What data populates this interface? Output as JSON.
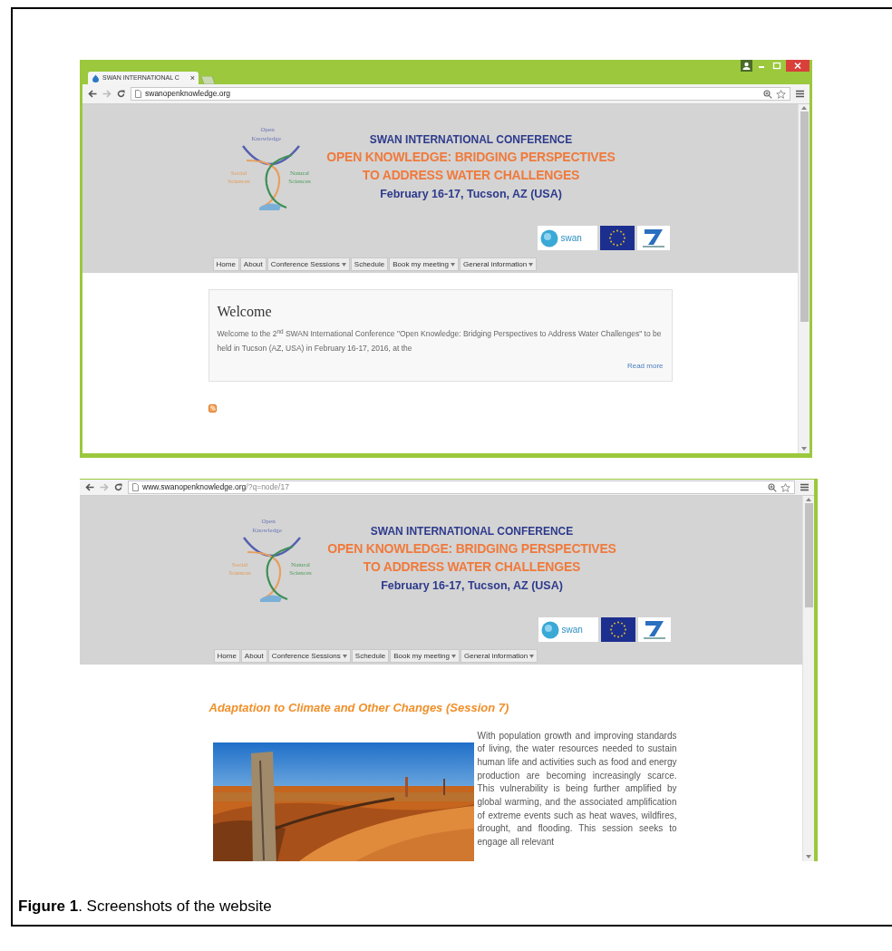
{
  "screenshots": [
    {
      "kind": "home",
      "title_bar": {
        "tab_title": "SWAN INTERNATIONAL C",
        "tab_close": "×"
      },
      "address": {
        "host": "swanopenknowledge.org"
      },
      "header": {
        "logo_labels": [
          "Open",
          "Knowledge",
          "Social Sciences",
          "Natural Sciences"
        ],
        "conference": "SWAN INTERNATIONAL CONFERENCE",
        "theme_lines": [
          "OPEN KNOWLEDGE: BRIDGING PERSPECTIVES",
          "TO ADDRESS WATER CHALLENGES"
        ],
        "date": "February 16-17, Tucson, AZ (USA)",
        "partner_text": "swan",
        "nav": [
          {
            "label": "Home",
            "dropdown": false
          },
          {
            "label": "About",
            "dropdown": false
          },
          {
            "label": "Conference Sessions",
            "dropdown": true
          },
          {
            "label": "Schedule",
            "dropdown": false
          },
          {
            "label": "Book my meeting",
            "dropdown": true
          },
          {
            "label": "General information",
            "dropdown": true
          }
        ]
      },
      "content": {
        "title": "Welcome",
        "text": "Welcome to the 2$^{nd}$ SWAN International Conference \"Open Knowledge: Bridging Perspectives to Address Water Challenges\" to be held in Tucson (AZ, USA) in February 16-17, 2016, at the",
        "link": "Read more"
      }
    },
    {
      "kind": "session",
      "address": {
        "host": "www.swanopenknowledge.org",
        "path": "/?q=node/17"
      },
      "header": {
        "logo_labels": [
          "Open",
          "Knowledge",
          "Social Sciences",
          "Natural Sciences"
        ],
        "conference": "SWAN INTERNATIONAL CONFERENCE",
        "theme_lines": [
          "OPEN KNOWLEDGE: BRIDGING PERSPECTIVES",
          "TO ADDRESS WATER CHALLENGES"
        ],
        "date": "February 16-17, Tucson, AZ (USA)",
        "partner_text": "swan",
        "nav": [
          {
            "label": "Home",
            "dropdown": false
          },
          {
            "label": "About",
            "dropdown": false
          },
          {
            "label": "Conference Sessions",
            "dropdown": true
          },
          {
            "label": "Schedule",
            "dropdown": false
          },
          {
            "label": "Book my meeting",
            "dropdown": true
          },
          {
            "label": "General information",
            "dropdown": true
          }
        ]
      },
      "content": {
        "title": "Adaptation to Climate and Other Changes (Session 7)",
        "text": "With population growth and improving standards of living, the water resources needed to sustain human life and activities such as food and energy production are becoming increasingly scarce. This vulnerability is being further amplified by global warming, and the associated amplification of extreme events such as heat waves, wildfires, drought, and flooding. This session seeks to engage all relevant"
      }
    }
  ],
  "caption": "**Figure 1**. Screenshots of the website"
}
